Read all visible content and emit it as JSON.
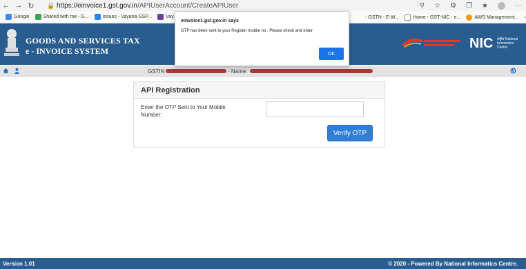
{
  "browser": {
    "url_host": "https://einvoice1.gst.gov.in",
    "url_path": "/APIUserAccount/CreateAPIUser",
    "bookmarks": [
      "Google",
      "Shared with me - G...",
      "Issues - Vayana GSP...",
      "Vay N"
    ],
    "bookmarks_right": [
      "- GSTN - E-W...",
      "Home - GST-NIC - e...",
      "AWS Management..."
    ]
  },
  "header": {
    "title_line1": "GOODS AND SERVICES TAX",
    "title_line2": "e - INVOICE SYSTEM",
    "nic_logo": "NIC",
    "nic_sub": "राष्ट्रीय National Informatics Centre"
  },
  "info_bar": {
    "gstin_label": "GSTIN",
    "name_label": "- Name:"
  },
  "form": {
    "heading": "API Registration",
    "otp_label": "Enter the OTP Sent to Your Mobile Number:",
    "otp_value": "",
    "verify_button": "Verify OTP"
  },
  "footer": {
    "version": "Version 1.01",
    "powered": "© 2020 - Powered By National Informatics Centre."
  },
  "dialog": {
    "title": "einvoice1.gst.gov.in says",
    "message": "OTP has been sent to your Register mobile no . Please check and enter",
    "ok_label": "OK"
  },
  "colors": {
    "header_bg": "#2a5d8f",
    "button_blue": "#2f7ed8",
    "redaction": "#a33a3a"
  }
}
